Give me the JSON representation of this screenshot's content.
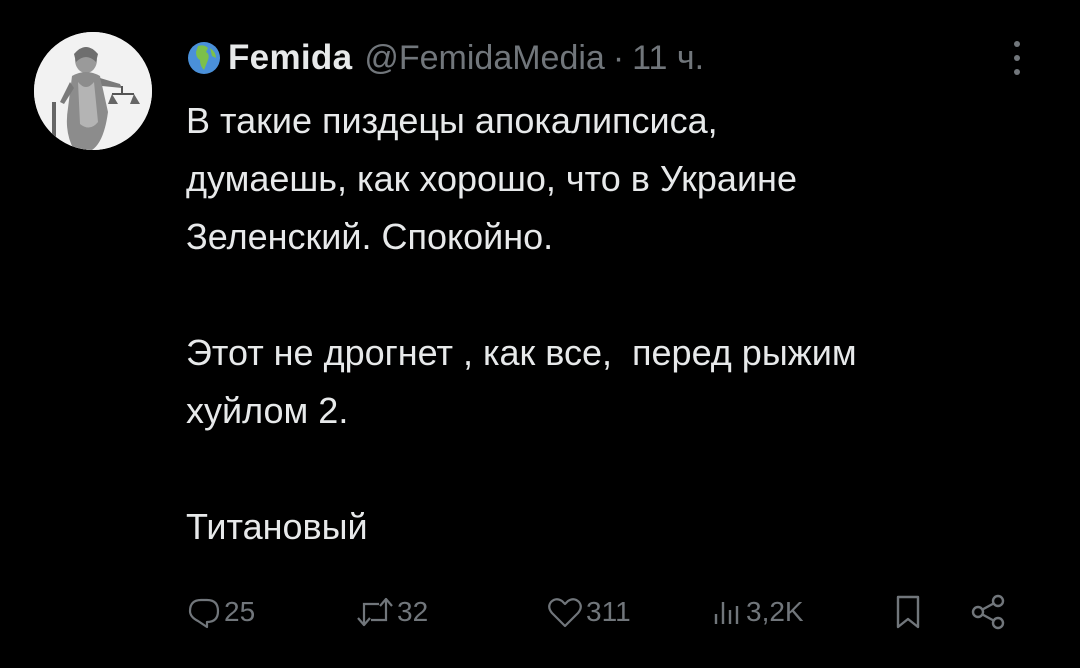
{
  "post": {
    "display_name": "Femida",
    "handle": "@FemidaMedia",
    "separator": "·",
    "time": "11 ч.",
    "text": "В такие пиздецы апокалипсиса,\nдумаешь, как хорошо, что в Украине\nЗеленский. Спокойно.\n\nЭтот не дрогнет , как все,  перед рыжим\nхуйлом 2.\n\nТитановый",
    "name_emoji_icon": "globe-africa-icon",
    "avatar_icon": "statue-of-justice-avatar"
  },
  "actions": {
    "replies": "25",
    "retweets": "32",
    "likes": "311",
    "views": "3,2K"
  },
  "colors": {
    "background": "#000000",
    "primary_text": "#e7e9ea",
    "secondary_text": "#71767b"
  }
}
